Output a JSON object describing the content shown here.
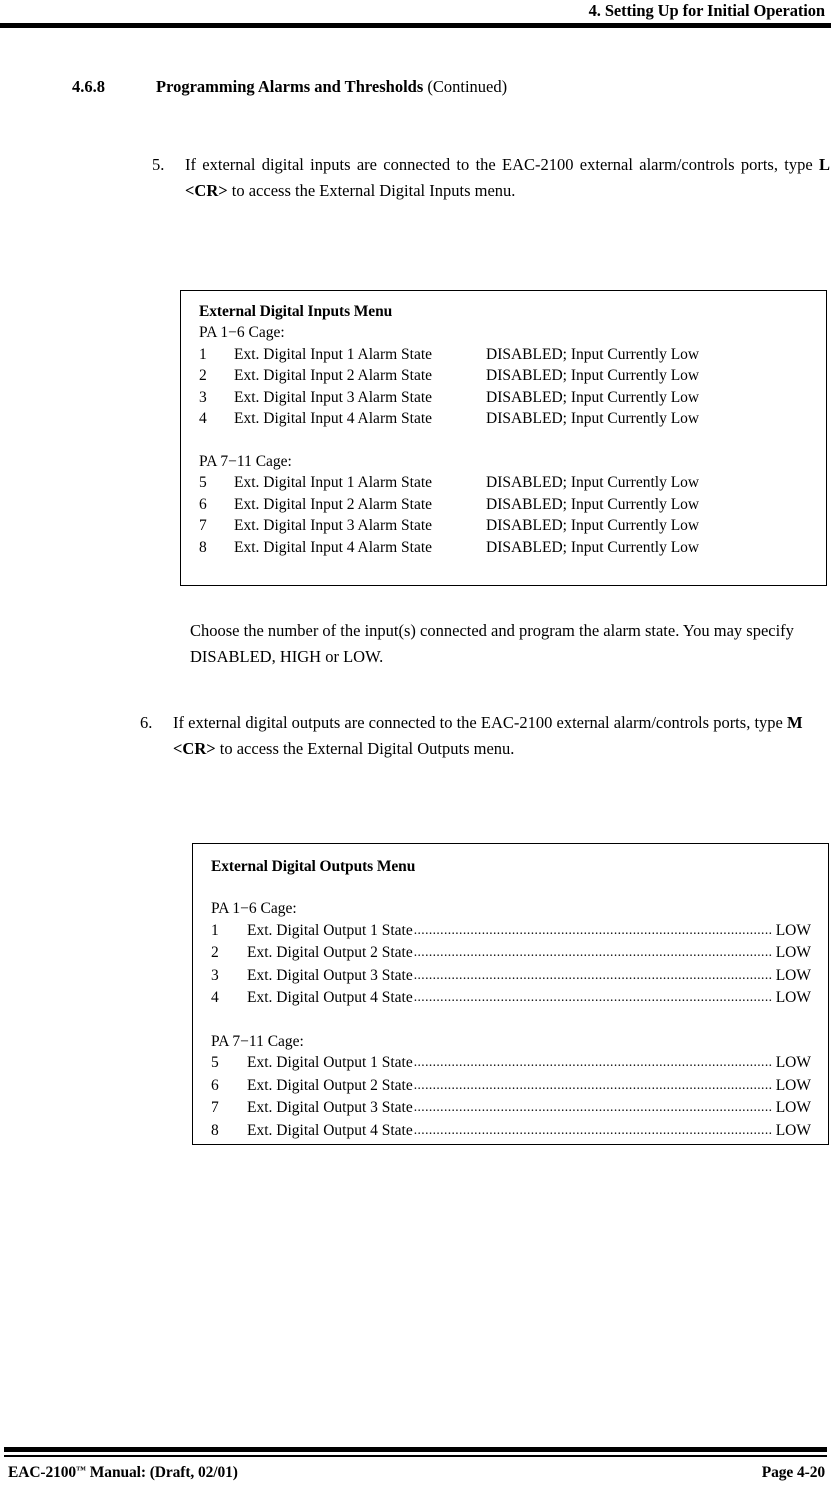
{
  "header": {
    "title": "4. Setting Up for Initial Operation"
  },
  "section": {
    "number": "4.6.8",
    "title": "Programming Alarms and Thresholds",
    "continued": "(Continued)"
  },
  "steps": [
    {
      "number": "5.",
      "text_before": "If external digital inputs are connected to the EAC-2100 external alarm/controls ports, type ",
      "command": "L <CR>",
      "text_after": " to access the External Digital Inputs menu."
    },
    {
      "number": "6.",
      "text_before": "If external digital outputs are connected to the EAC-2100 external alarm/controls ports, type ",
      "command": "M <CR>",
      "text_after": " to access the External Digital Outputs menu."
    }
  ],
  "note": "Choose the number of the input(s) connected and program the alarm state. You may specify DISABLED, HIGH or LOW.",
  "inputs_menu": {
    "title": "External Digital Inputs Menu",
    "groups": [
      {
        "label": "PA 1−6 Cage:",
        "rows": [
          {
            "index": "1",
            "label": "Ext. Digital Input 1 Alarm State",
            "value": "DISABLED; Input Currently Low"
          },
          {
            "index": "2",
            "label": "Ext. Digital Input 2 Alarm State",
            "value": "DISABLED; Input Currently Low"
          },
          {
            "index": "3",
            "label": "Ext. Digital Input 3 Alarm State",
            "value": "DISABLED; Input Currently Low"
          },
          {
            "index": "4",
            "label": "Ext. Digital Input 4 Alarm State",
            "value": "DISABLED; Input Currently Low"
          }
        ]
      },
      {
        "label": "PA 7−11 Cage:",
        "rows": [
          {
            "index": "5",
            "label": "Ext. Digital Input 1 Alarm State",
            "value": "DISABLED; Input Currently Low"
          },
          {
            "index": "6",
            "label": "Ext. Digital Input 2 Alarm State",
            "value": "DISABLED; Input Currently Low"
          },
          {
            "index": "7",
            "label": "Ext. Digital Input 3 Alarm State",
            "value": "DISABLED; Input Currently Low"
          },
          {
            "index": "8",
            "label": "Ext. Digital Input 4 Alarm State",
            "value": "DISABLED; Input Currently Low"
          }
        ]
      }
    ]
  },
  "outputs_menu": {
    "title": "External Digital Outputs Menu",
    "groups": [
      {
        "label": "PA 1−6 Cage:",
        "rows": [
          {
            "index": "1",
            "label": "Ext. Digital Output 1 State",
            "value": "LOW"
          },
          {
            "index": "2",
            "label": "Ext. Digital Output 2 State",
            "value": "LOW"
          },
          {
            "index": "3",
            "label": "Ext. Digital Output 3 State",
            "value": "LOW"
          },
          {
            "index": "4",
            "label": "Ext. Digital Output 4 State",
            "value": "LOW"
          }
        ]
      },
      {
        "label": "PA 7−11 Cage:",
        "rows": [
          {
            "index": "5",
            "label": "Ext. Digital Output 1 State",
            "value": "LOW"
          },
          {
            "index": "6",
            "label": "Ext. Digital Output 2 State",
            "value": "LOW"
          },
          {
            "index": "7",
            "label": "Ext. Digital Output 3 State",
            "value": "LOW"
          },
          {
            "index": "8",
            "label": "Ext. Digital Output 4 State",
            "value": "LOW"
          }
        ]
      }
    ]
  },
  "footer": {
    "manual_prefix": "EAC-2100",
    "manual_tm": "™",
    "manual_suffix": " Manual: (Draft, 02/01)",
    "page": "Page 4-20"
  }
}
